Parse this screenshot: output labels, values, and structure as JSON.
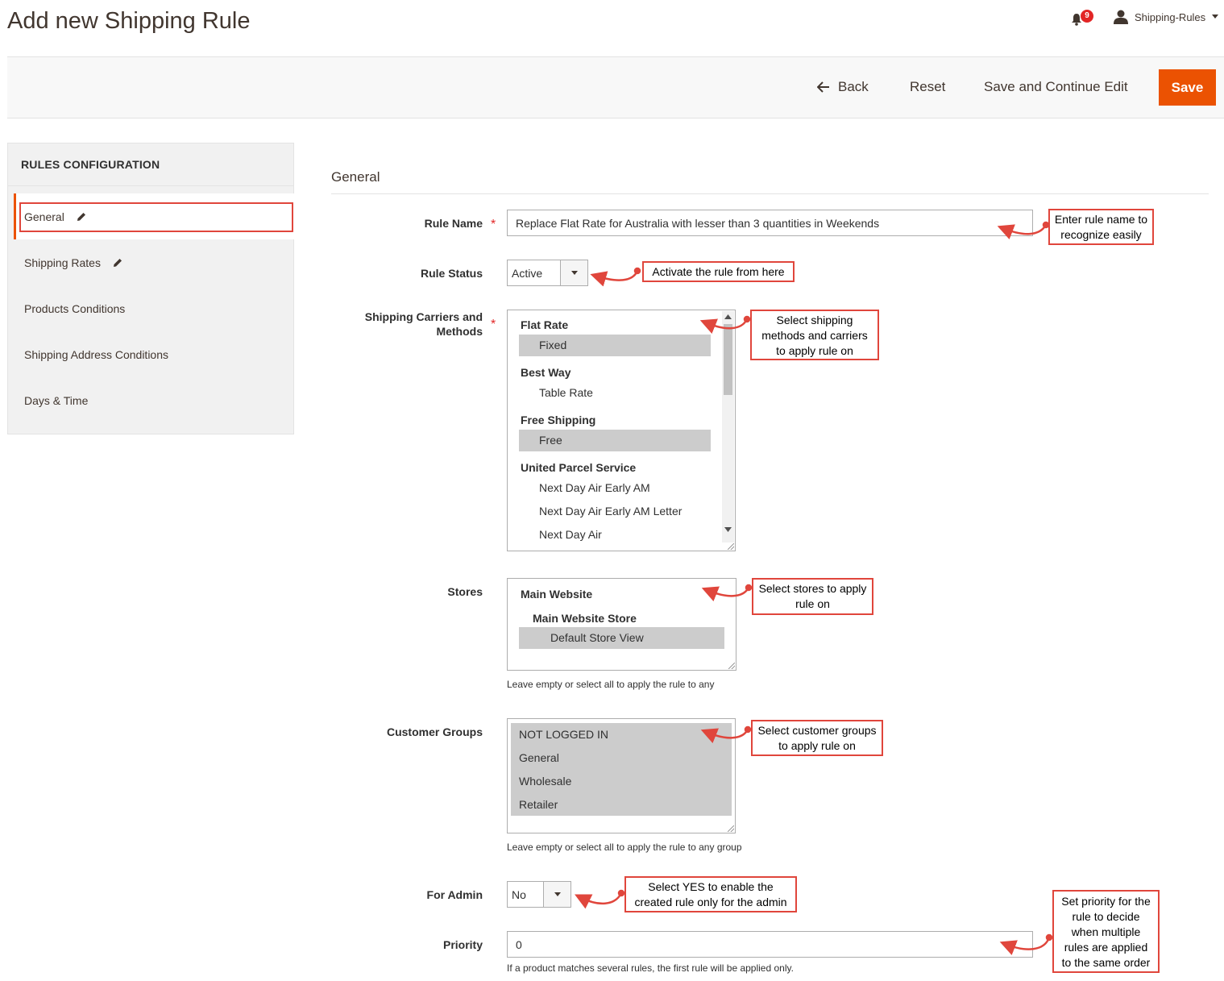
{
  "page": {
    "title": "Add new Shipping Rule"
  },
  "header": {
    "notifications_count": "9",
    "user_name": "Shipping-Rules"
  },
  "actions": {
    "back": "Back",
    "reset": "Reset",
    "save_continue": "Save and Continue Edit",
    "save": "Save"
  },
  "sidebar": {
    "title": "RULES CONFIGURATION",
    "items": [
      {
        "label": "General"
      },
      {
        "label": "Shipping Rates"
      },
      {
        "label": "Products Conditions"
      },
      {
        "label": "Shipping Address Conditions"
      },
      {
        "label": "Days & Time"
      }
    ]
  },
  "form": {
    "section_title": "General",
    "rule_name": {
      "label": "Rule Name",
      "value": "Replace Flat Rate for Australia with lesser than 3 quantities in Weekends"
    },
    "rule_status": {
      "label": "Rule Status",
      "value": "Active"
    },
    "carriers": {
      "label_line1": "Shipping Carriers and",
      "label_line2": "Methods",
      "options": [
        {
          "text": "Flat Rate"
        },
        {
          "text": "Fixed"
        },
        {
          "text": "Best Way"
        },
        {
          "text": "Table Rate"
        },
        {
          "text": "Free Shipping"
        },
        {
          "text": "Free"
        },
        {
          "text": "United Parcel Service"
        },
        {
          "text": "Next Day Air Early AM"
        },
        {
          "text": "Next Day Air Early AM Letter"
        },
        {
          "text": "Next Day Air"
        }
      ]
    },
    "stores": {
      "label": "Stores",
      "options": [
        {
          "text": "Main Website"
        },
        {
          "text": "Main Website Store"
        },
        {
          "text": "Default Store View"
        }
      ],
      "note": "Leave empty or select all to apply the rule to any"
    },
    "customer_groups": {
      "label": "Customer Groups",
      "options": [
        {
          "text": "NOT LOGGED IN"
        },
        {
          "text": "General"
        },
        {
          "text": "Wholesale"
        },
        {
          "text": "Retailer"
        }
      ],
      "note": "Leave empty or select all to apply the rule to any group"
    },
    "for_admin": {
      "label": "For Admin",
      "value": "No"
    },
    "priority": {
      "label": "Priority",
      "value": "0",
      "note": "If a product matches several rules, the first rule will be applied only."
    }
  },
  "annotations": {
    "rule_name": [
      "Enter rule name to",
      "recognize easily"
    ],
    "rule_status": [
      "Activate the rule from here"
    ],
    "carriers": [
      "Select shipping",
      "methods and carriers",
      "to apply rule on"
    ],
    "stores": [
      "Select stores to apply",
      "rule on"
    ],
    "groups": [
      "Select customer groups",
      "to apply rule on"
    ],
    "admin": [
      "Select YES to enable the",
      "created rule only for the admin"
    ],
    "priority": [
      "Set priority for the",
      "rule to decide",
      "when multiple",
      "rules are applied",
      "to the same order"
    ]
  },
  "colors": {
    "accent": "#eb5202",
    "annotation": "#e0463c",
    "selected_option": "#cccccc"
  }
}
